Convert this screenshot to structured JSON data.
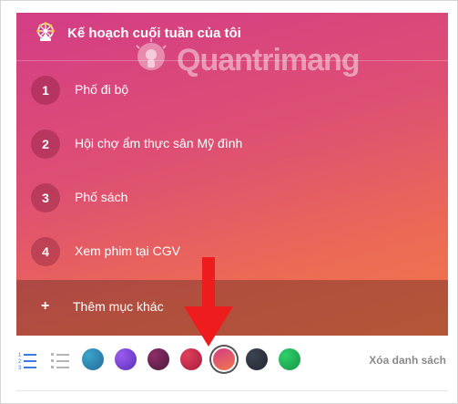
{
  "card": {
    "title": "Kế hoạch cuối tuần của tôi",
    "title_icon": "ferris-wheel-icon",
    "items": [
      {
        "number": "1",
        "text": "Phố đi bộ"
      },
      {
        "number": "2",
        "text": "Hội chợ ẩm thực sân Mỹ đình"
      },
      {
        "number": "3",
        "text": "Phố sách"
      },
      {
        "number": "4",
        "text": "Xem phim tại CGV"
      }
    ],
    "add_item": {
      "icon": "+",
      "label": "Thêm mục khác"
    }
  },
  "watermark": {
    "text": "Quantrimang"
  },
  "toolbar": {
    "numbered_list_icon": "numbered-list-icon",
    "bulleted_list_icon": "bulleted-list-icon",
    "colors": [
      {
        "name": "teal-blue",
        "hex": "#2e86ab"
      },
      {
        "name": "purple",
        "hex": "#7b3fd0"
      },
      {
        "name": "plum",
        "hex": "#6e2350"
      },
      {
        "name": "crimson",
        "hex": "#c4264a"
      },
      {
        "name": "pink-orange",
        "hex": "#e8546a",
        "selected": true
      },
      {
        "name": "charcoal",
        "hex": "#2f3440"
      },
      {
        "name": "green",
        "hex": "#1fae54"
      }
    ],
    "clear_label": "Xóa danh sách"
  },
  "annotation": {
    "arrow_color": "#ee1c1c"
  }
}
